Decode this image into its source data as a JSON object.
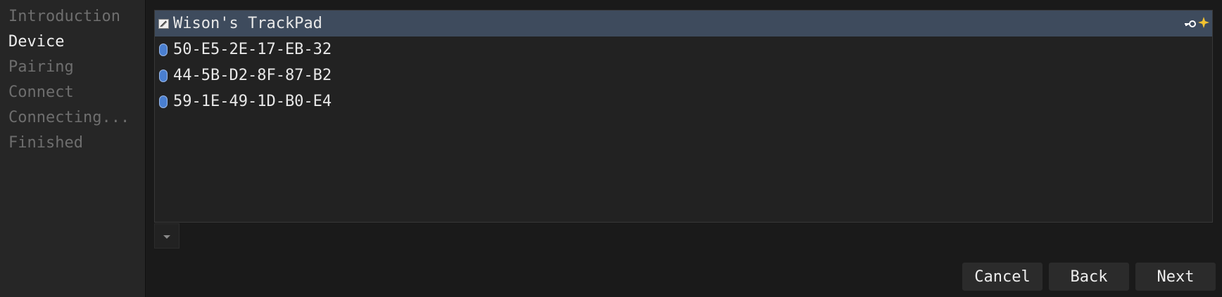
{
  "sidebar": {
    "steps": [
      {
        "label": "Introduction",
        "state": "inactive"
      },
      {
        "label": "Device",
        "state": "current"
      },
      {
        "label": "Pairing",
        "state": "inactive"
      },
      {
        "label": "Connect",
        "state": "inactive"
      },
      {
        "label": "Connecting...",
        "state": "inactive"
      },
      {
        "label": "Finished",
        "state": "inactive"
      }
    ]
  },
  "devices": [
    {
      "name": "Wison's TrackPad",
      "icon": "trackpad-icon",
      "selected": true,
      "badges": [
        "key-icon",
        "sparkle-icon"
      ]
    },
    {
      "name": "50-E5-2E-17-EB-32",
      "icon": "bluetooth-icon",
      "selected": false
    },
    {
      "name": "44-5B-D2-8F-87-B2",
      "icon": "bluetooth-icon",
      "selected": false
    },
    {
      "name": "59-1E-49-1D-B0-E4",
      "icon": "bluetooth-icon",
      "selected": false
    }
  ],
  "expander": {
    "icon": "chevron-down-icon"
  },
  "buttons": {
    "cancel": "Cancel",
    "back": "Back",
    "next": "Next"
  },
  "colors": {
    "selection": "#3e4b5d",
    "bluetooth": "#4a7fd0",
    "sparkle": "#f2c230"
  }
}
